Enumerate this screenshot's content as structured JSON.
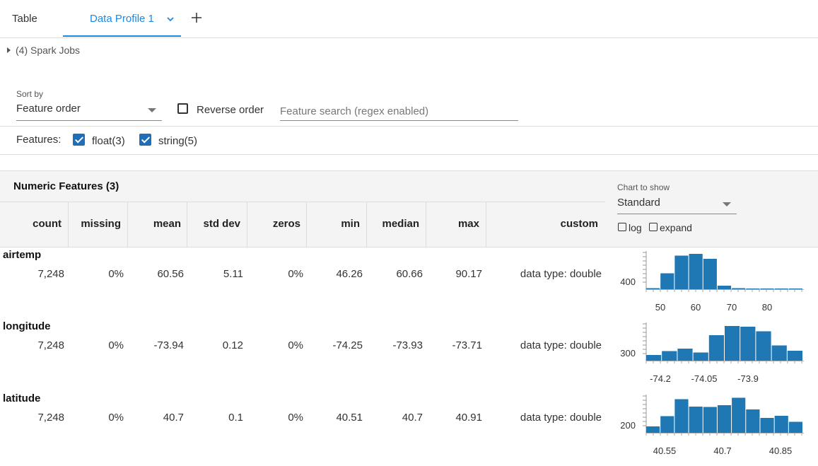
{
  "tabs": [
    {
      "label": "Table"
    },
    {
      "label": "Data Profile 1"
    }
  ],
  "spark_jobs": "(4) Spark Jobs",
  "sort": {
    "label": "Sort by",
    "value": "Feature order"
  },
  "reverse_order": {
    "label": "Reverse order",
    "checked": false
  },
  "feature_search": {
    "placeholder": "Feature search (regex enabled)",
    "value": ""
  },
  "features": {
    "label": "Features:",
    "filters": [
      {
        "label": "float(3)",
        "checked": true
      },
      {
        "label": "string(5)",
        "checked": true
      }
    ]
  },
  "numeric": {
    "title": "Numeric Features (3)",
    "columns": [
      "count",
      "missing",
      "mean",
      "std dev",
      "zeros",
      "min",
      "median",
      "max",
      "custom"
    ],
    "rows": [
      {
        "name": "airtemp",
        "values": [
          "7,248",
          "0%",
          "60.56",
          "5.11",
          "0%",
          "46.26",
          "60.66",
          "90.17",
          "data type: double"
        ]
      },
      {
        "name": "longitude",
        "values": [
          "7,248",
          "0%",
          "-73.94",
          "0.12",
          "0%",
          "-74.25",
          "-73.93",
          "-73.71",
          "data type: double"
        ]
      },
      {
        "name": "latitude",
        "values": [
          "7,248",
          "0%",
          "40.7",
          "0.1",
          "0%",
          "40.51",
          "40.7",
          "40.91",
          "data type: double"
        ]
      }
    ]
  },
  "chart_panel": {
    "label": "Chart to show",
    "value": "Standard",
    "log_label": "log",
    "expand_label": "expand",
    "log_checked": false,
    "expand_checked": false
  },
  "bar_color": "#1f77b4",
  "accent_color": "#1e88e5",
  "chart_data": [
    {
      "type": "bar",
      "series": "airtemp",
      "ytick": "400",
      "xticks": [
        "50",
        "60",
        "70",
        "80"
      ],
      "values": [
        0.03,
        0.45,
        0.95,
        1.0,
        0.86,
        0.1,
        0.03,
        0.01,
        0.01,
        0.01,
        0.01
      ]
    },
    {
      "type": "bar",
      "series": "longitude",
      "ytick": "300",
      "xticks": [
        "-74.2",
        "-74.05",
        "-73.9"
      ],
      "values": [
        0.16,
        0.27,
        0.34,
        0.23,
        0.72,
        0.98,
        0.96,
        0.83,
        0.43,
        0.28
      ]
    },
    {
      "type": "bar",
      "series": "latitude",
      "ytick": "200",
      "xticks": [
        "40.55",
        "40.7",
        "40.85"
      ],
      "values": [
        0.18,
        0.47,
        0.95,
        0.74,
        0.73,
        0.78,
        0.99,
        0.66,
        0.42,
        0.48,
        0.31
      ]
    }
  ]
}
